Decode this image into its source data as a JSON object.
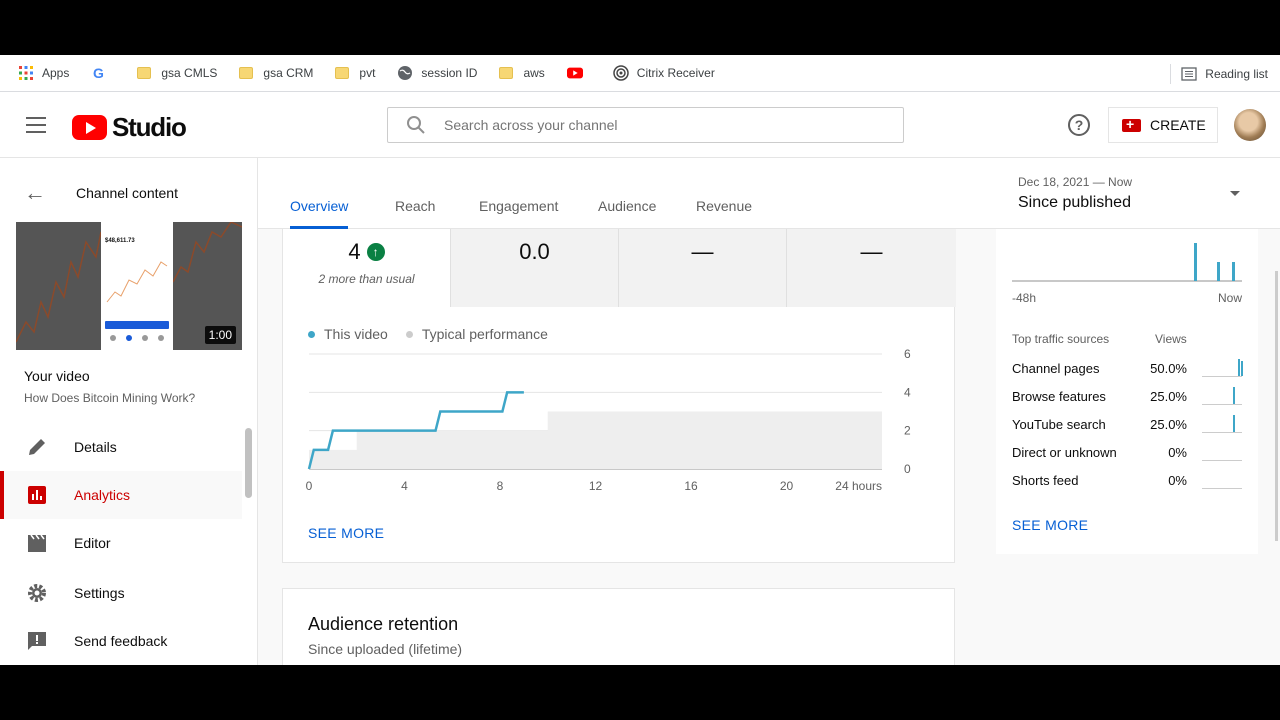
{
  "bookmarks": {
    "items": [
      {
        "label": "Apps",
        "icon": "apps-grid-icon"
      },
      {
        "label": "",
        "icon": "google-icon"
      },
      {
        "label": "gsa CMLS",
        "icon": "folder-icon"
      },
      {
        "label": "gsa CRM",
        "icon": "folder-icon"
      },
      {
        "label": "pvt",
        "icon": "folder-icon"
      },
      {
        "label": "session ID",
        "icon": "globe-icon"
      },
      {
        "label": "aws",
        "icon": "folder-icon"
      },
      {
        "label": "",
        "icon": "youtube-icon"
      },
      {
        "label": "Citrix Receiver",
        "icon": "citrix-icon"
      }
    ],
    "reading_list": "Reading list"
  },
  "header": {
    "brand": "Studio",
    "search_placeholder": "Search across your channel",
    "create_label": "CREATE"
  },
  "sidebar": {
    "back_label": "Channel content",
    "duration": "1:00",
    "your_video": "Your video",
    "video_title": "How Does Bitcoin Mining Work?",
    "items": [
      {
        "label": "Details",
        "icon": "pencil-icon"
      },
      {
        "label": "Analytics",
        "icon": "analytics-icon"
      },
      {
        "label": "Editor",
        "icon": "clapper-icon"
      },
      {
        "label": "Settings",
        "icon": "gear-icon"
      },
      {
        "label": "Send feedback",
        "icon": "feedback-icon"
      }
    ]
  },
  "tabs": [
    "Overview",
    "Reach",
    "Engagement",
    "Audience",
    "Revenue"
  ],
  "date_range": {
    "range": "Dec 18, 2021 — Now",
    "label": "Since published"
  },
  "metrics": [
    {
      "value": "4",
      "note": "2 more than usual"
    },
    {
      "value": "0.0",
      "note": ""
    },
    {
      "value": "—",
      "note": ""
    },
    {
      "value": "—",
      "note": ""
    }
  ],
  "see_more": "SEE MORE",
  "realtime": {
    "label_left": "-48h",
    "label_right": "Now",
    "traffic_header": "Top traffic sources",
    "views_header": "Views",
    "sources": [
      {
        "name": "Channel pages",
        "pct": "50.0%"
      },
      {
        "name": "Browse features",
        "pct": "25.0%"
      },
      {
        "name": "YouTube search",
        "pct": "25.0%"
      },
      {
        "name": "Direct or unknown",
        "pct": "0%"
      },
      {
        "name": "Shorts feed",
        "pct": "0%"
      }
    ]
  },
  "retention": {
    "title": "Audience retention",
    "subtitle": "Since uploaded (lifetime)"
  },
  "chart_data": {
    "type": "line",
    "legend": [
      "This video",
      "Typical performance"
    ],
    "x_ticks": [
      "0",
      "4",
      "8",
      "12",
      "16",
      "20",
      "24 hours"
    ],
    "y_ticks": [
      "0",
      "2",
      "4",
      "6"
    ],
    "xlim": [
      0,
      24
    ],
    "ylim": [
      0,
      6
    ],
    "series": [
      {
        "name": "This video",
        "color": "#3ea6c8",
        "x": [
          0,
          0.2,
          0.8,
          1.0,
          5.3,
          5.5,
          8.1,
          8.3,
          9.0
        ],
        "y": [
          0,
          1,
          1,
          2,
          2,
          3,
          3,
          4,
          4
        ]
      },
      {
        "name": "Typical performance",
        "color": "#e0e0e0",
        "x": [
          0,
          1.5,
          2,
          9,
          10,
          23,
          24
        ],
        "lower": [
          0,
          0,
          0,
          0,
          0,
          0,
          0
        ],
        "upper": [
          1,
          1,
          2,
          2,
          3,
          3,
          4
        ]
      }
    ]
  }
}
